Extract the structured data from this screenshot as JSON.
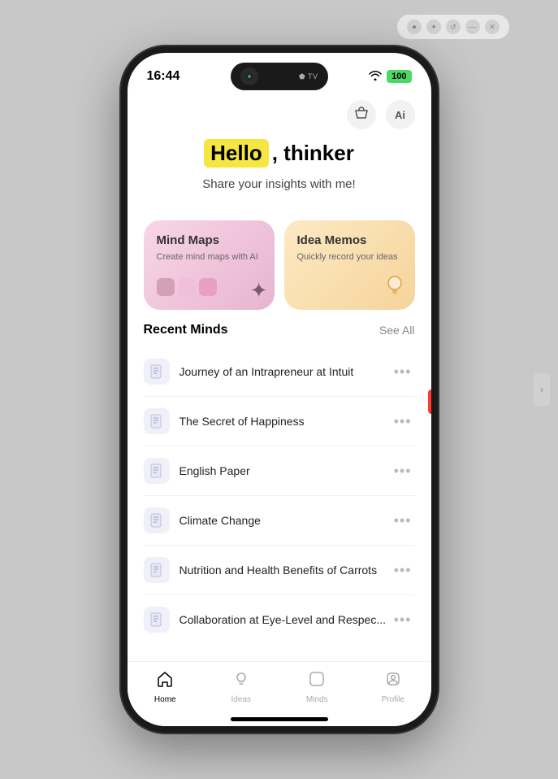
{
  "window": {
    "chrome_buttons": [
      "⟳",
      "✦",
      "↺",
      "—",
      "✕"
    ]
  },
  "status_bar": {
    "time": "16:44",
    "app_label": "⬟ TV",
    "wifi": "WiFi",
    "battery": "100"
  },
  "dynamic_island": {
    "right_label": "⬟ TV"
  },
  "header": {
    "basket_icon": "🛍",
    "ai_icon": "Ai"
  },
  "hero": {
    "hello_highlight": "Hello",
    "hello_rest": ", thinker",
    "subtitle": "Share your insights with me!"
  },
  "cards": [
    {
      "id": "mindmaps",
      "title": "Mind Maps",
      "subtitle": "Create mind maps with AI",
      "deco": "✦",
      "swatches": [
        "#e8a0c0",
        "#f0c0d8",
        "#d4a0b8"
      ]
    },
    {
      "id": "ideamemos",
      "title": "Idea Memos",
      "subtitle": "Quickly record your ideas",
      "deco": "💡"
    }
  ],
  "recent_minds": {
    "section_title": "Recent Minds",
    "see_all_label": "See All",
    "items": [
      {
        "title": "Journey of an Intrapreneur at Intuit"
      },
      {
        "title": "The Secret of Happiness"
      },
      {
        "title": "English Paper"
      },
      {
        "title": "Climate Change"
      },
      {
        "title": "Nutrition and Health Benefits of Carrots"
      },
      {
        "title": "Collaboration at Eye-Level and Respec..."
      }
    ]
  },
  "bottom_nav": {
    "items": [
      {
        "id": "home",
        "label": "Home",
        "icon": "⌂",
        "active": true
      },
      {
        "id": "ideas",
        "label": "Ideas",
        "icon": "💡",
        "active": false
      },
      {
        "id": "minds",
        "label": "Minds",
        "icon": "⬜",
        "active": false
      },
      {
        "id": "profile",
        "label": "Profile",
        "icon": "◻",
        "active": false
      }
    ]
  }
}
